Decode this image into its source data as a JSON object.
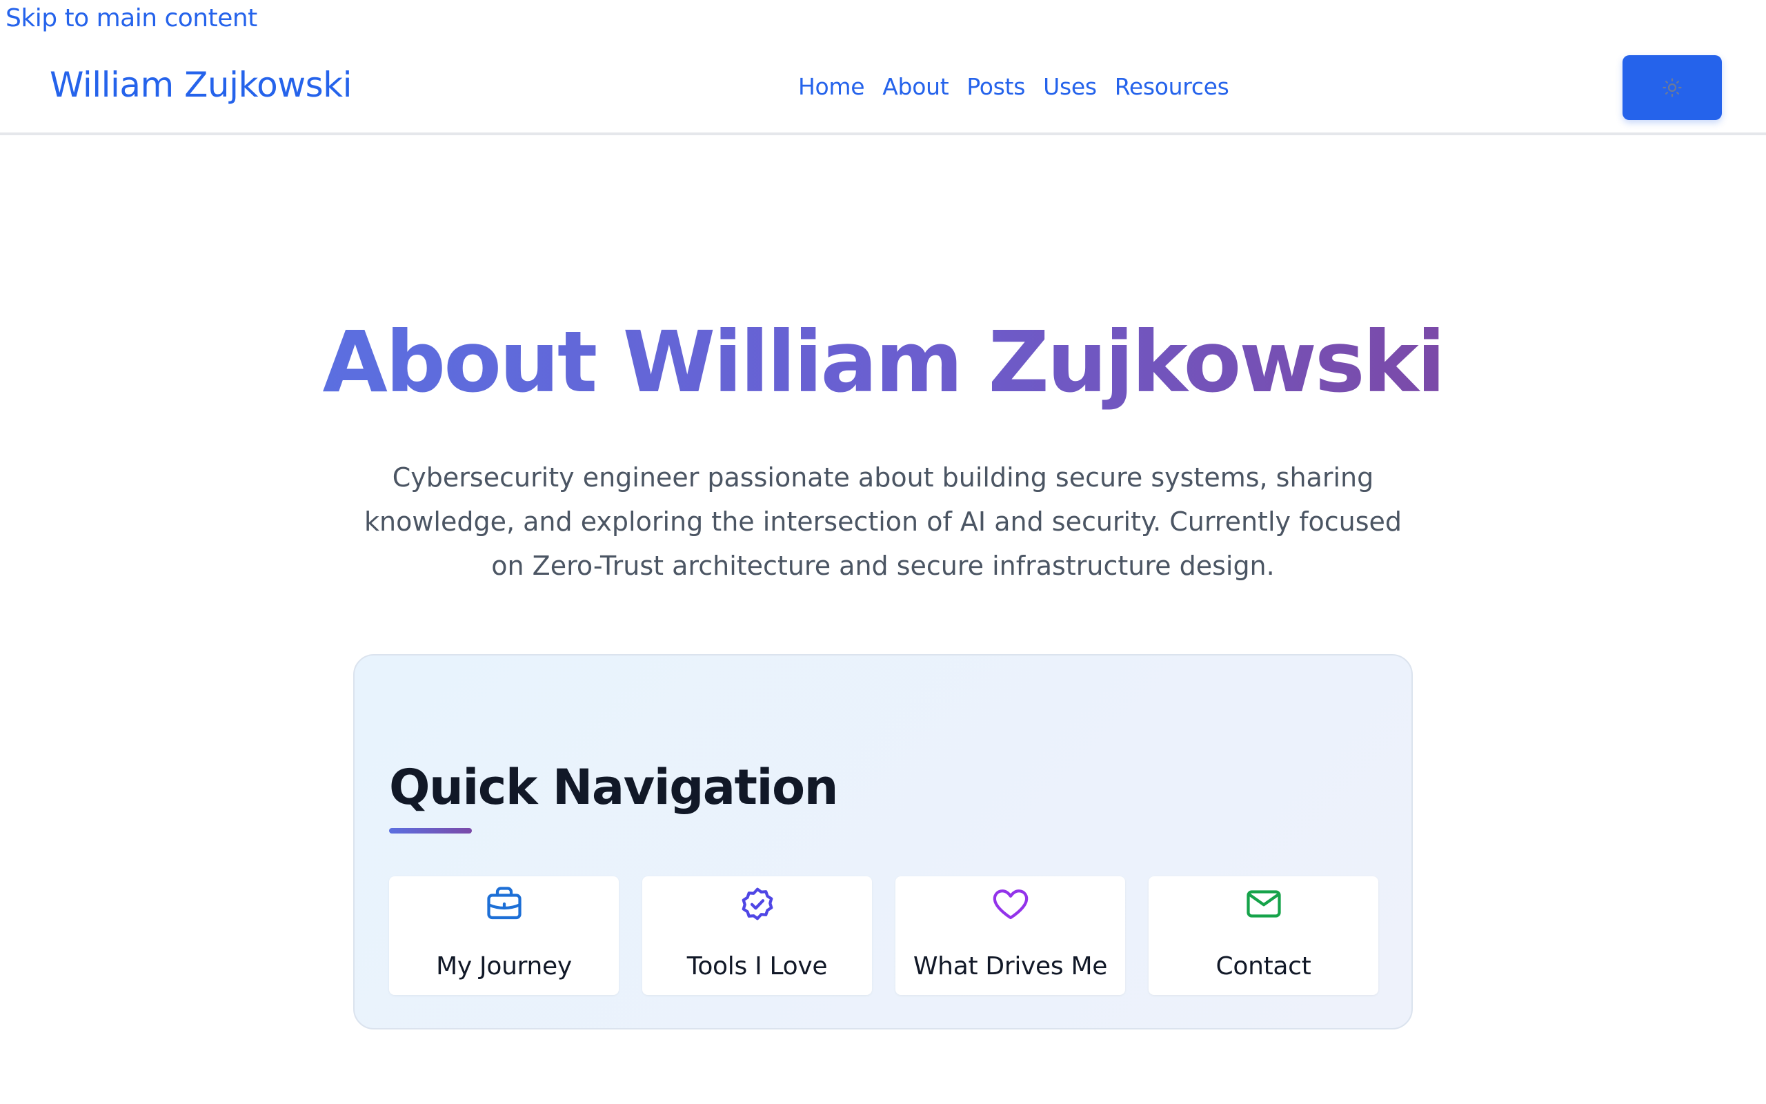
{
  "skip_link": "Skip to main content",
  "header": {
    "brand": "William Zujkowski",
    "nav": [
      "Home",
      "About",
      "Posts",
      "Uses",
      "Resources"
    ],
    "theme_toggle_icon": "sun-icon"
  },
  "hero": {
    "title": "About William Zujkowski",
    "subtitle": "Cybersecurity engineer passionate about building secure systems, sharing knowledge, and exploring the intersection of AI and security. Currently focused on Zero-Trust architecture and secure infrastructure design."
  },
  "quick_nav": {
    "title": "Quick Navigation",
    "items": [
      {
        "label": "My Journey",
        "icon": "briefcase-icon",
        "color": "#1d6fd6"
      },
      {
        "label": "Tools I Love",
        "icon": "badge-check-icon",
        "color": "#4f46e5"
      },
      {
        "label": "What Drives Me",
        "icon": "heart-icon",
        "color": "#9333ea"
      },
      {
        "label": "Contact",
        "icon": "mail-icon",
        "color": "#16a34a"
      }
    ]
  },
  "colors": {
    "accent": "#2563eb",
    "title_gradient_start": "#5b6fe0",
    "title_gradient_end": "#7b4aa8"
  }
}
